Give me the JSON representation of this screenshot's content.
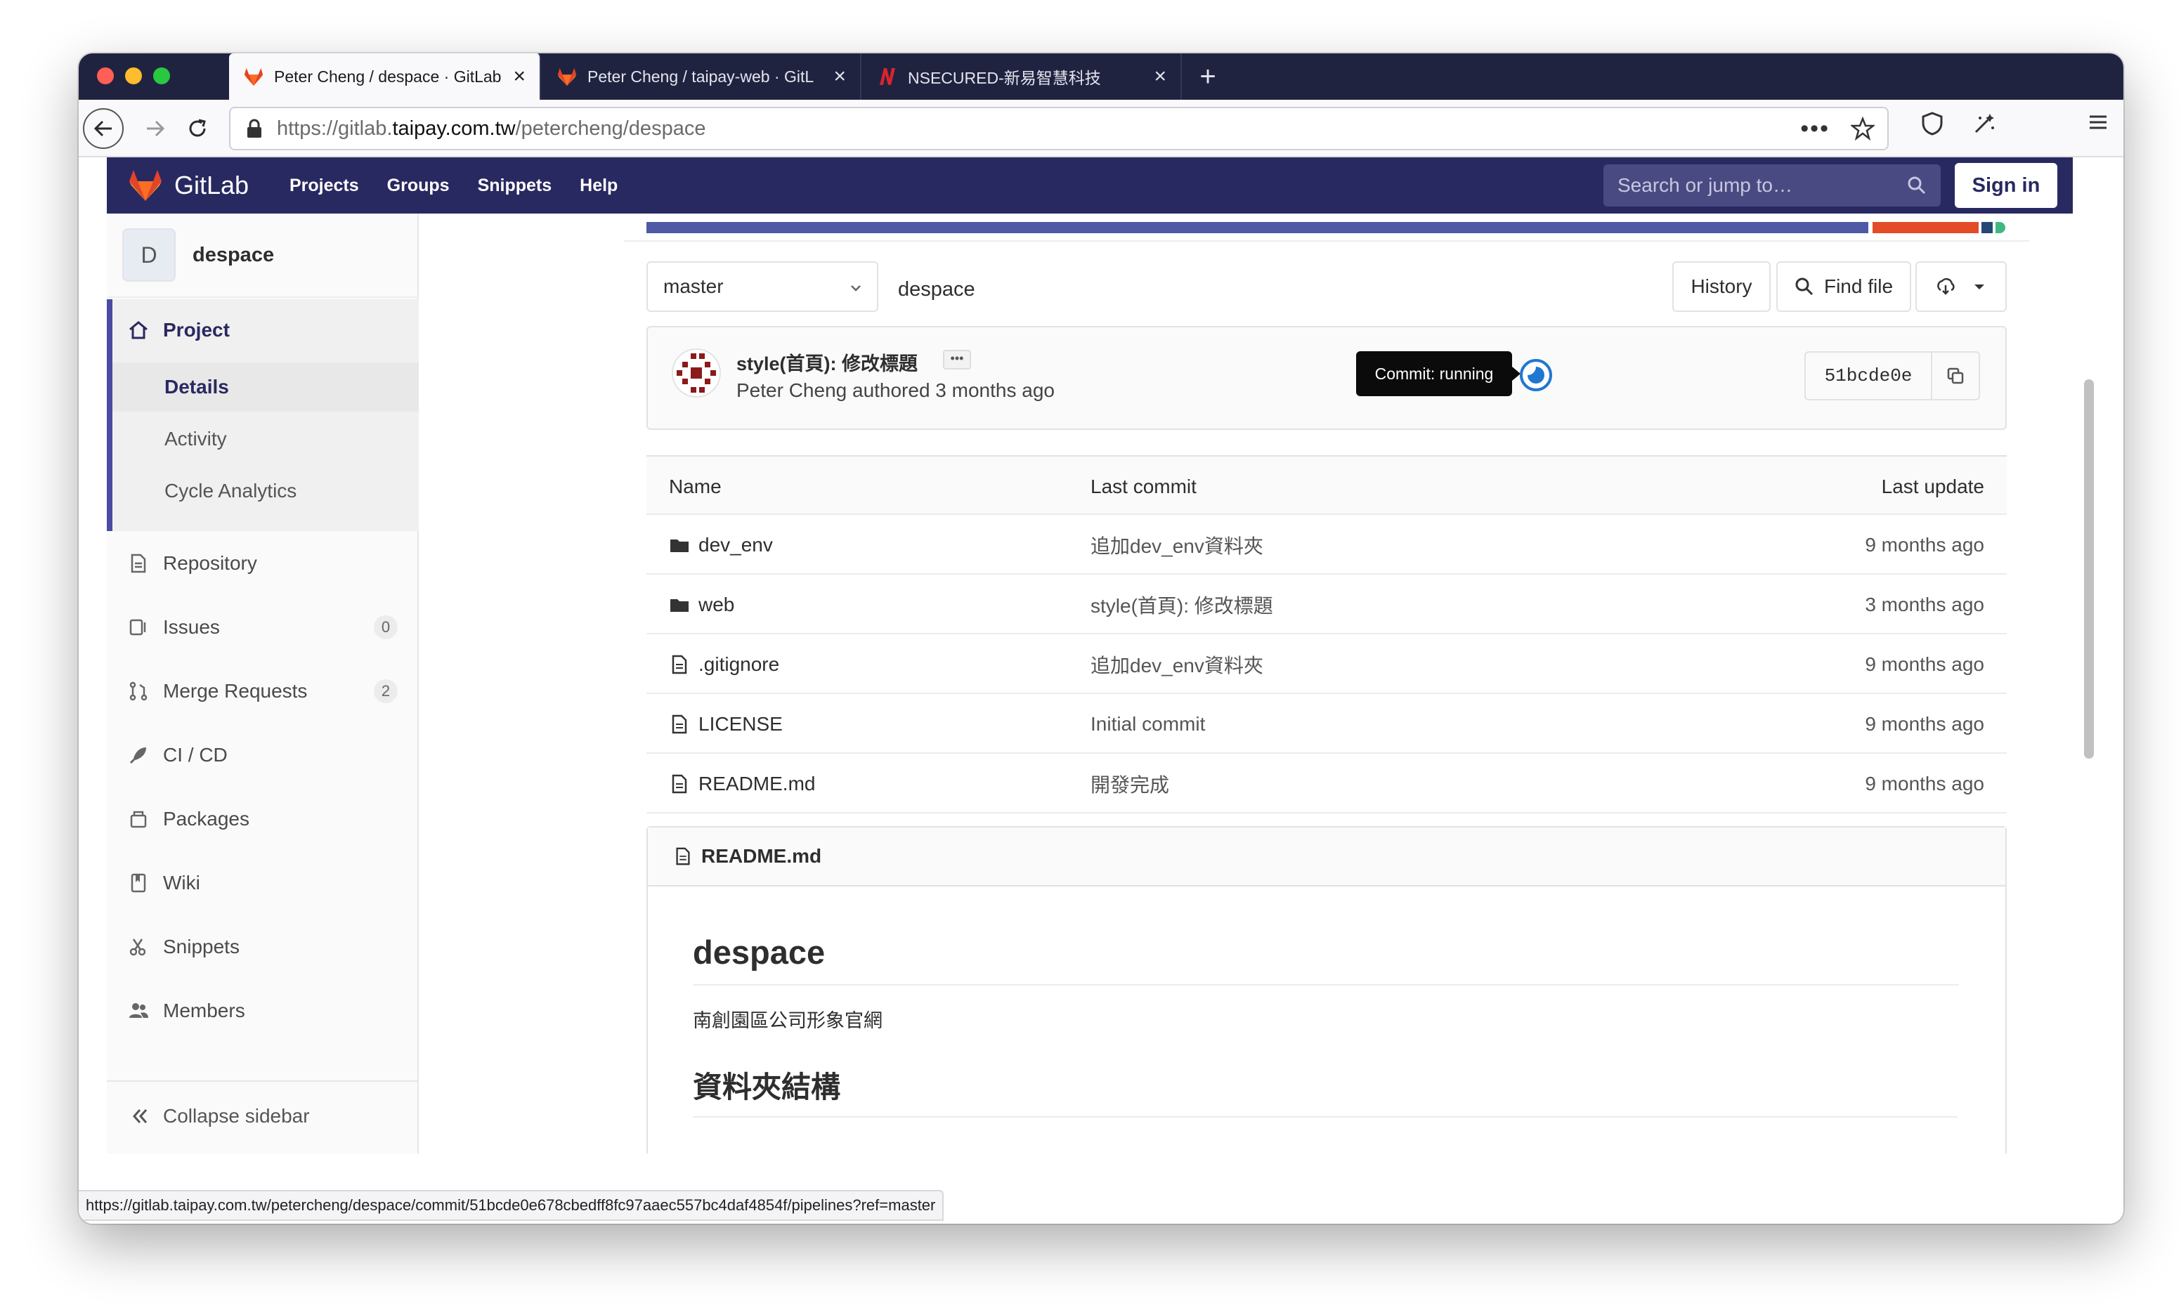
{
  "browser": {
    "tabs": [
      {
        "label": "Peter Cheng / despace · GitLab",
        "active": true
      },
      {
        "label": "Peter Cheng / taipay-web · GitL",
        "active": false
      },
      {
        "label": "NSECURED-新易智慧科技",
        "active": false
      }
    ],
    "url_prefix": "https://gitlab.",
    "url_host": "taipay.com.tw",
    "url_path": "/petercheng/despace",
    "status_url": "https://gitlab.taipay.com.tw/petercheng/despace/commit/51bcde0e678cbedff8fc97aaec557bc4daf4854f/pipelines?ref=master"
  },
  "header": {
    "logo": "GitLab",
    "nav": [
      "Projects",
      "Groups",
      "Snippets",
      "Help"
    ],
    "search_placeholder": "Search or jump to…",
    "sign_in": "Sign in"
  },
  "sidebar": {
    "avatar_letter": "D",
    "project_name": "despace",
    "project_label": "Project",
    "project_sub": [
      "Details",
      "Activity",
      "Cycle Analytics"
    ],
    "items": [
      {
        "label": "Repository",
        "icon": "doc-icon"
      },
      {
        "label": "Issues",
        "icon": "issues-icon",
        "badge": "0"
      },
      {
        "label": "Merge Requests",
        "icon": "merge-request-icon",
        "badge": "2"
      },
      {
        "label": "CI / CD",
        "icon": "rocket-icon"
      },
      {
        "label": "Packages",
        "icon": "package-icon"
      },
      {
        "label": "Wiki",
        "icon": "book-icon"
      },
      {
        "label": "Snippets",
        "icon": "scissors-icon"
      },
      {
        "label": "Members",
        "icon": "users-icon"
      }
    ],
    "collapse": "Collapse sidebar"
  },
  "repo": {
    "branch": "master",
    "path": "despace",
    "history": "History",
    "find_file": "Find file",
    "commit": {
      "title": "style(首頁): 修改標題",
      "author": "Peter Cheng authored 3 months ago",
      "tooltip": "Commit: running",
      "sha": "51bcde0e"
    },
    "language_colors": [
      "#4e5aa5",
      "#e34c26",
      "#244776",
      "#41b883"
    ],
    "table": {
      "headers": [
        "Name",
        "Last commit",
        "Last update"
      ],
      "rows": [
        {
          "name": "dev_env",
          "type": "folder",
          "commit": "追加dev_env資料夾",
          "updated": "9 months ago"
        },
        {
          "name": "web",
          "type": "folder",
          "commit": "style(首頁): 修改標題",
          "updated": "3 months ago"
        },
        {
          "name": ".gitignore",
          "type": "file",
          "commit": "追加dev_env資料夾",
          "updated": "9 months ago"
        },
        {
          "name": "LICENSE",
          "type": "file",
          "commit": "Initial commit",
          "updated": "9 months ago"
        },
        {
          "name": "README.md",
          "type": "file",
          "commit": "開發完成",
          "updated": "9 months ago"
        }
      ]
    },
    "readme": {
      "filename": "README.md",
      "h1": "despace",
      "p": "南創園區公司形象官網",
      "h2": "資料夾結構"
    }
  }
}
